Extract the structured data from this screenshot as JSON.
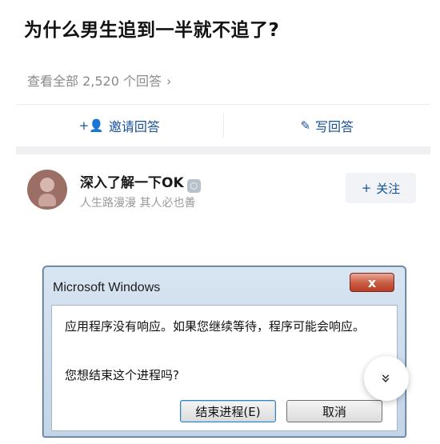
{
  "question": {
    "title": "为什么男生追到一半就不追了?",
    "view_all": "查看全部 2,520 个回答",
    "view_all_chevron": "›"
  },
  "actions": {
    "invite_icon": "+👤",
    "invite_label": "邀请回答",
    "write_icon": "✎",
    "write_label": "写回答"
  },
  "author": {
    "name": "深入了解一下OK",
    "badge_icon": "⬡",
    "bio": "人生路漫漫 其人必也善",
    "follow_icon": "+",
    "follow_label": "关注"
  },
  "dialog": {
    "title": "Microsoft Windows",
    "close_glyph": "x",
    "message": "应用程序没有响应。如果您继续等待，程序可能会响应。",
    "question": "您想结束这个进程吗?",
    "end_button": "结束进程(E)",
    "cancel_button": "取消"
  },
  "fab": {
    "glyph": "»"
  },
  "colors": {
    "link_blue": "#175199",
    "muted_gray": "#8a8a8a",
    "divider": "#f0f0f2"
  }
}
